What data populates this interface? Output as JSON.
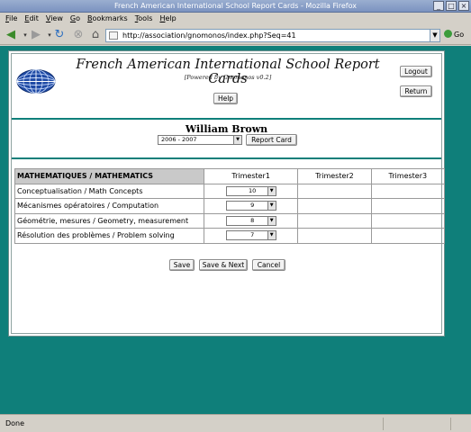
{
  "window": {
    "title": "French American International School Report Cards - Mozilla Firefox"
  },
  "menu": [
    "File",
    "Edit",
    "View",
    "Go",
    "Bookmarks",
    "Tools",
    "Help"
  ],
  "nav": {
    "url": "http://association/gnomonos/index.php?Seq=41",
    "go_label": "Go"
  },
  "header": {
    "title": "French American International School Report Cards",
    "powered": "[Powered by Gnomonos  v0.2]",
    "help_label": "Help",
    "logout_label": "Logout",
    "return_label": "Return"
  },
  "student": {
    "name": "William Brown",
    "year_selected": "2006 - 2007",
    "report_card_label": "Report Card"
  },
  "grades": {
    "subject": "MATHEMATIQUES / MATHEMATICS",
    "trimesters": [
      "Trimester1",
      "Trimester2",
      "Trimester3"
    ],
    "rows": [
      {
        "label": "Conceptualisation / Math Concepts",
        "t1": "10"
      },
      {
        "label": "Mécanismes opératoires / Computation",
        "t1": "9"
      },
      {
        "label": "Géométrie, mesures / Geometry, measurement",
        "t1": "8"
      },
      {
        "label": "Résolution des problèmes / Problem solving",
        "t1": "7"
      }
    ]
  },
  "actions": {
    "save_label": "Save",
    "save_next_label": "Save & Next",
    "cancel_label": "Cancel"
  },
  "status": {
    "text": "Done"
  }
}
